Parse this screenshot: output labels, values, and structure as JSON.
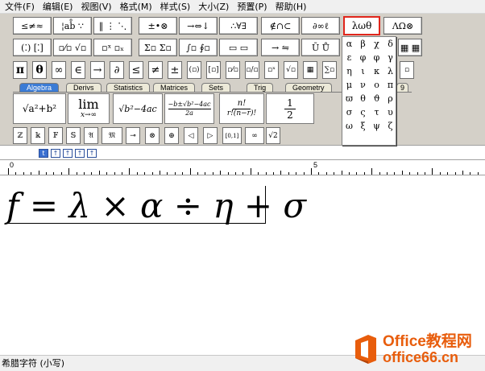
{
  "menubar": {
    "items": [
      "文件(F)",
      "编辑(E)",
      "视图(V)",
      "格式(M)",
      "样式(S)",
      "大小(Z)",
      "预置(P)",
      "帮助(H)"
    ]
  },
  "toolbar": {
    "row1": [
      "≤≠≈",
      "¦ab̊ ∵",
      "‖ ⋮ ⋱",
      "±•⊗",
      "→⇔↓",
      "∴∀∃",
      "∉∩⊂",
      "∂∞ℓ",
      "λωθ",
      "ΛΩ⊗"
    ],
    "row2": [
      "(⁚) [⁚]",
      "▫⁄▫ √▫",
      "▫ˣ ▫ₓ",
      "Σ▫ Σ▫",
      "∫▫ ∮▫",
      "▭ ▭",
      "→ ⇋",
      "Ū Ů",
      "▦ ▦"
    ],
    "row3": [
      "π",
      "θ",
      "∞",
      "∈",
      "→",
      "∂",
      "≤",
      "≠",
      "±",
      "(▫)",
      "[▫]",
      "▫⁄▫",
      "▫/▫",
      "▫ˣ",
      "√▫",
      "▦",
      "∑▫",
      "∫▫",
      "▭",
      "→",
      "Ů",
      "▦",
      "▫"
    ],
    "tabs": [
      "Algebra",
      "Derivs",
      "Statistics",
      "Matrices",
      "Sets",
      "Trig",
      "Geometry",
      "9"
    ],
    "active_tab": "Algebra",
    "templates": [
      "√a²+b²",
      "lim",
      "x→∞",
      "√b²−4ac",
      "−b±√b²−4ac",
      "2a",
      "n!",
      "r!(n−r)!",
      "1",
      "2"
    ],
    "bottom_row": [
      "ℤ",
      "𝕜",
      "𝔽",
      "𝕊",
      "𝔄",
      "𝔐",
      "⊸",
      "⊗",
      "⊕",
      "◁",
      "▷",
      "[0,1]",
      "∞",
      "√2"
    ]
  },
  "greek_panel": {
    "symbols": [
      "α",
      "β",
      "χ",
      "δ",
      "ε",
      "φ",
      "φ",
      "γ",
      "η",
      "ι",
      "κ",
      "λ",
      "μ",
      "ν",
      "ο",
      "π",
      "ϖ",
      "θ",
      "ϑ",
      "ρ",
      "σ",
      "ς",
      "τ",
      "υ",
      "ω",
      "ξ",
      "ψ",
      "ζ"
    ]
  },
  "nav": [
    "t",
    "↑",
    "↑",
    "↑",
    "↑"
  ],
  "ruler": {
    "mark0": "0",
    "mark5": "5"
  },
  "formula": {
    "f": "f",
    "eq": "=",
    "lambda": "λ",
    "times": "×",
    "alpha": "α",
    "div": "÷",
    "eta": "η",
    "plus": "+",
    "sigma": "σ"
  },
  "status": {
    "text": "希腊字符 (小写)"
  },
  "watermark": {
    "line1": "Office教程网",
    "line2": "office66.cn"
  },
  "colors": {
    "selected_border": "#e0261c",
    "active_tab": "#3a7bd5",
    "watermark_orange": "#e85d0c"
  }
}
